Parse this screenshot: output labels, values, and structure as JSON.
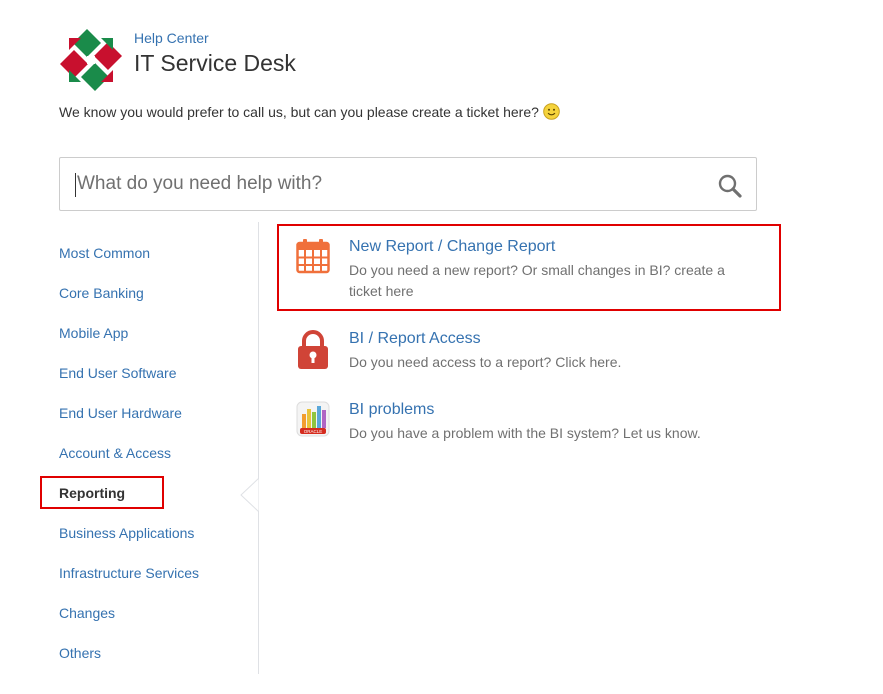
{
  "header": {
    "help_center": "Help Center",
    "title": "IT Service Desk",
    "tagline": "We know you would prefer to call us, but can you please create a ticket here?"
  },
  "search": {
    "placeholder": "What do you need help with?"
  },
  "sidebar": {
    "items": [
      {
        "label": "Most Common"
      },
      {
        "label": "Core Banking"
      },
      {
        "label": "Mobile App"
      },
      {
        "label": "End User Software"
      },
      {
        "label": "End User Hardware"
      },
      {
        "label": "Account & Access"
      },
      {
        "label": "Reporting",
        "active": true
      },
      {
        "label": "Business Applications"
      },
      {
        "label": "Infrastructure Services"
      },
      {
        "label": "Changes"
      },
      {
        "label": "Others"
      }
    ]
  },
  "requests": [
    {
      "name": "New Report / Change Report",
      "description": "Do you need a new report? Or small changes in BI? create a ticket here",
      "icon": "calendar-icon"
    },
    {
      "name": "BI / Report Access",
      "description": "Do you need access to a report? Click here.",
      "icon": "lock-icon"
    },
    {
      "name": "BI problems",
      "description": "Do you have a problem with the BI system? Let us know.",
      "icon": "bar-chart-icon",
      "icon_badge": "ORACLE"
    }
  ],
  "colors": {
    "link": "#3572b0",
    "highlight": "#e00000",
    "icon_orange": "#f0703b",
    "lock_red": "#d04437"
  }
}
